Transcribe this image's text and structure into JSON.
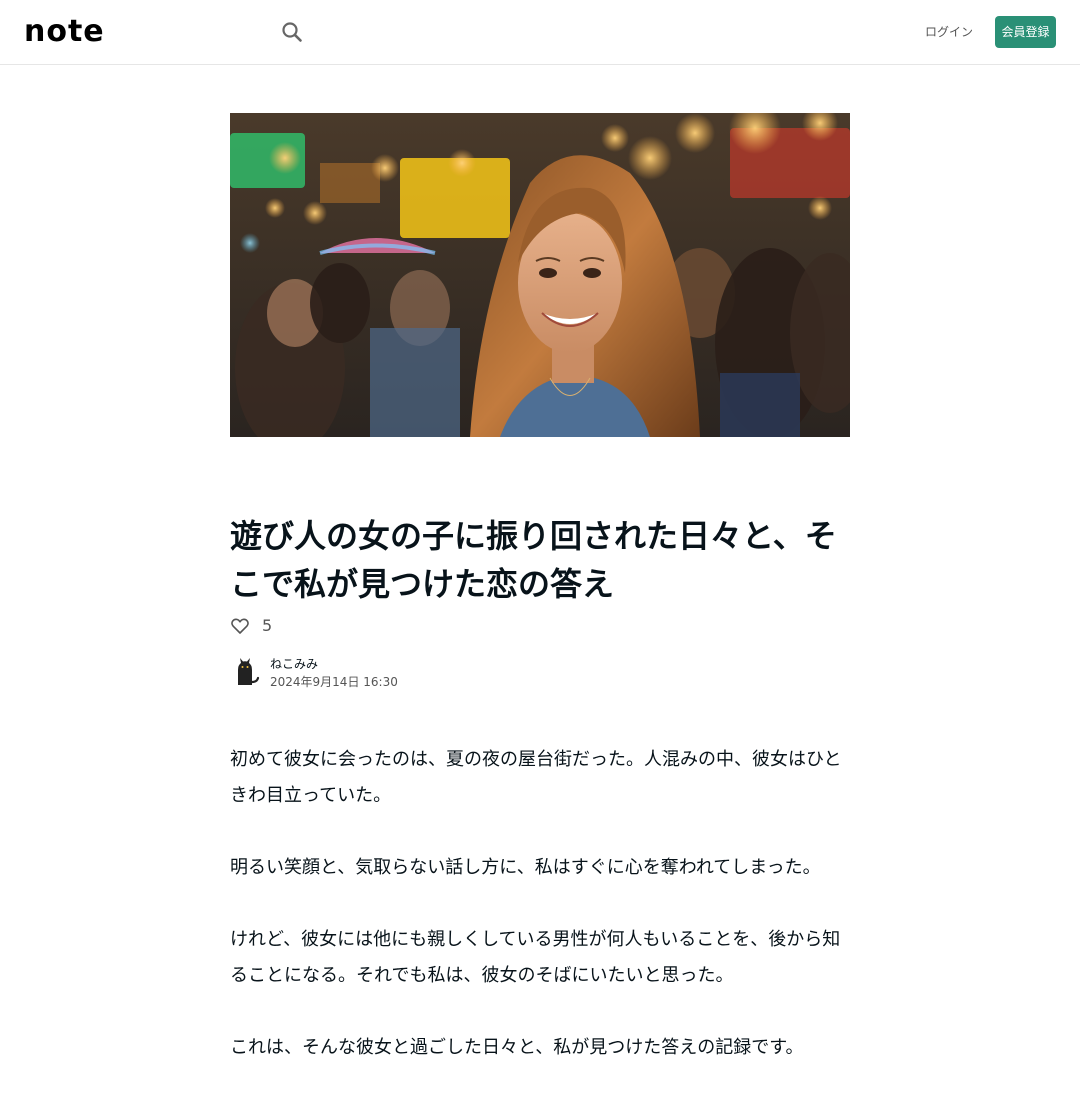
{
  "header": {
    "logo": "note",
    "search_icon": "search-icon",
    "login_label": "ログイン",
    "signup_label": "会員登録"
  },
  "article": {
    "title": "遊び人の女の子に振り回された日々と、そこで私が見つけた恋の答え",
    "likes": "5",
    "author": "ねこみみ",
    "date": "2024年9月14日 16:30",
    "paragraphs": [
      "初めて彼女に会ったのは、夏の夜の屋台街だった。人混みの中、彼女はひときわ目立っていた。",
      "明るい笑顔と、気取らない話し方に、私はすぐに心を奪われてしまった。",
      "けれど、彼女には他にも親しくしている男性が何人もいることを、後から知ることになる。それでも私は、彼女のそばにいたいと思った。",
      "これは、そんな彼女と過ごした日々と、私が見つけた答えの記録です。"
    ]
  },
  "colors": {
    "accent": "#2a9076",
    "text": "#08131a",
    "muted": "#555555"
  }
}
